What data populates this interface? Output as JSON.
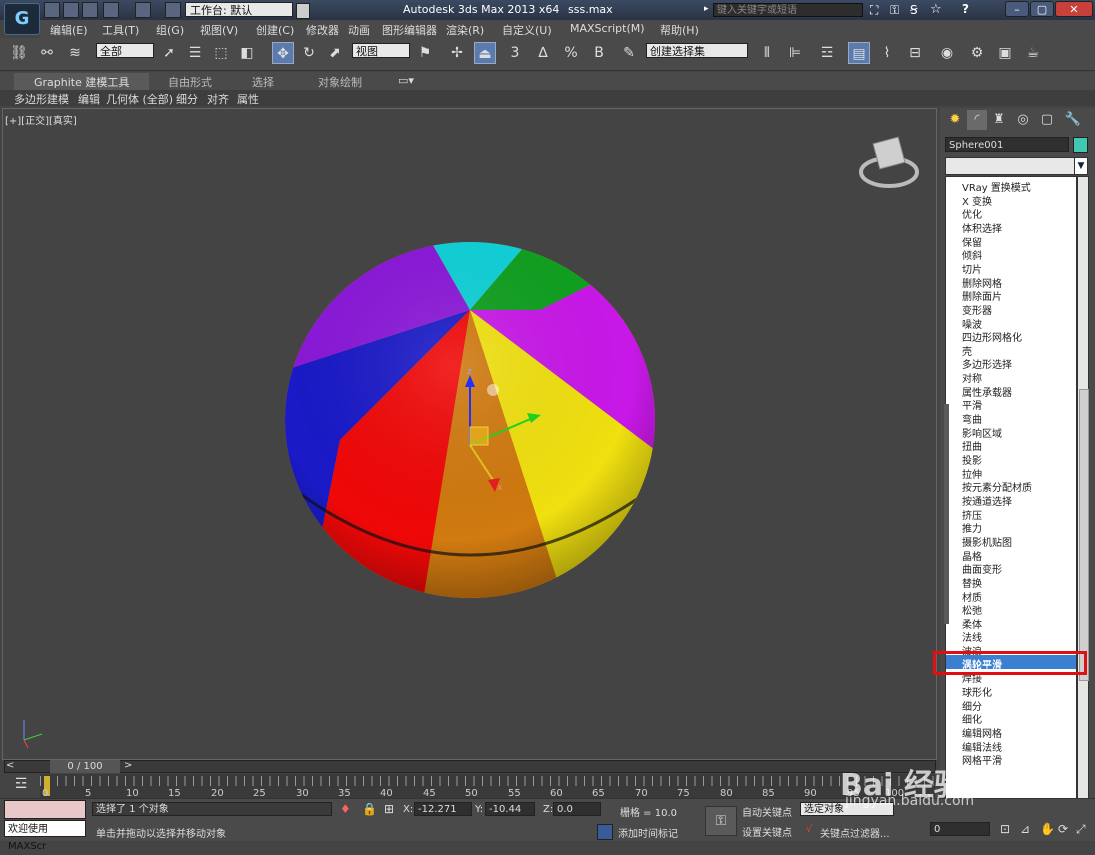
{
  "titlebar": {
    "workspace": "工作台: 默认",
    "title": "Autodesk 3ds Max  2013 x64",
    "filename": "sss.max",
    "search_placeholder": "键入关键字或短语",
    "help_label": "?"
  },
  "menubar": {
    "items": [
      "编辑(E)",
      "工具(T)",
      "组(G)",
      "视图(V)",
      "创建(C)",
      "修改器",
      "动画",
      "图形编辑器",
      "渲染(R)",
      "自定义(U)",
      "MAXScript(M)",
      "帮助(H)"
    ]
  },
  "toolbar": {
    "selection_filter": "全部",
    "ref_coord": "视图",
    "named_selection": "创建选择集",
    "snap_3": "3",
    "snap_angle": "∆",
    "snap_percent": "%",
    "spinner_snap": "B"
  },
  "ribbon": {
    "tabs": [
      "Graphite 建模工具",
      "自由形式",
      "选择",
      "对象绘制"
    ],
    "subtabs": [
      "多边形建模",
      "编辑",
      "几何体 (全部)",
      "细分",
      "对齐",
      "属性"
    ]
  },
  "viewport": {
    "label": "[+][正交][真实]",
    "gizmo_z": "z",
    "gizmo_x": "x"
  },
  "command_panel": {
    "object_name": "Sphere001",
    "object_color": "#40c8b0",
    "modifier_list": [
      "VRay 置换模式",
      "X 变换",
      "优化",
      "体积选择",
      "保留",
      "倾斜",
      "切片",
      "删除网格",
      "删除面片",
      "变形器",
      "噪波",
      "四边形网格化",
      "壳",
      "多边形选择",
      "对称",
      "属性承载器",
      "平滑",
      "弯曲",
      "影响区域",
      "扭曲",
      "投影",
      "拉伸",
      "按元素分配材质",
      "按通道选择",
      "挤压",
      "推力",
      "摄影机贴图",
      "晶格",
      "曲面变形",
      "替换",
      "材质",
      "松弛",
      "柔体",
      "法线",
      "波浪",
      "涡轮平滑",
      "焊接",
      "球形化",
      "细分",
      "细化",
      "编辑网格",
      "编辑法线",
      "网格平滑"
    ],
    "selected_modifier": "涡轮平滑"
  },
  "timeline": {
    "frame_counter": "0 / 100",
    "ticks": [
      "0",
      "5",
      "10",
      "15",
      "20",
      "25",
      "30",
      "35",
      "40",
      "45",
      "50",
      "55",
      "60",
      "65",
      "70",
      "75",
      "80",
      "85",
      "90",
      "95",
      "100"
    ]
  },
  "status": {
    "welcome": "欢迎使用 MAXScr",
    "selected": "选择了 1 个对象",
    "prompt": "单击并拖动以选择并移动对象",
    "x_label": "X:",
    "x_value": "-12.271",
    "y_label": "Y:",
    "y_value": "-10.44",
    "z_label": "Z:",
    "z_value": "0.0",
    "grid": "栅格 = 10.0",
    "add_time_tag": "添加时间标记",
    "auto_key": "自动关键点",
    "set_key": "设置关键点",
    "selected_object": "选定对象",
    "key_filters": "关键点过滤器...",
    "frame_field": "0"
  },
  "watermark": {
    "brand": "Bai 经验",
    "url": "jingyan.baidu.com"
  }
}
